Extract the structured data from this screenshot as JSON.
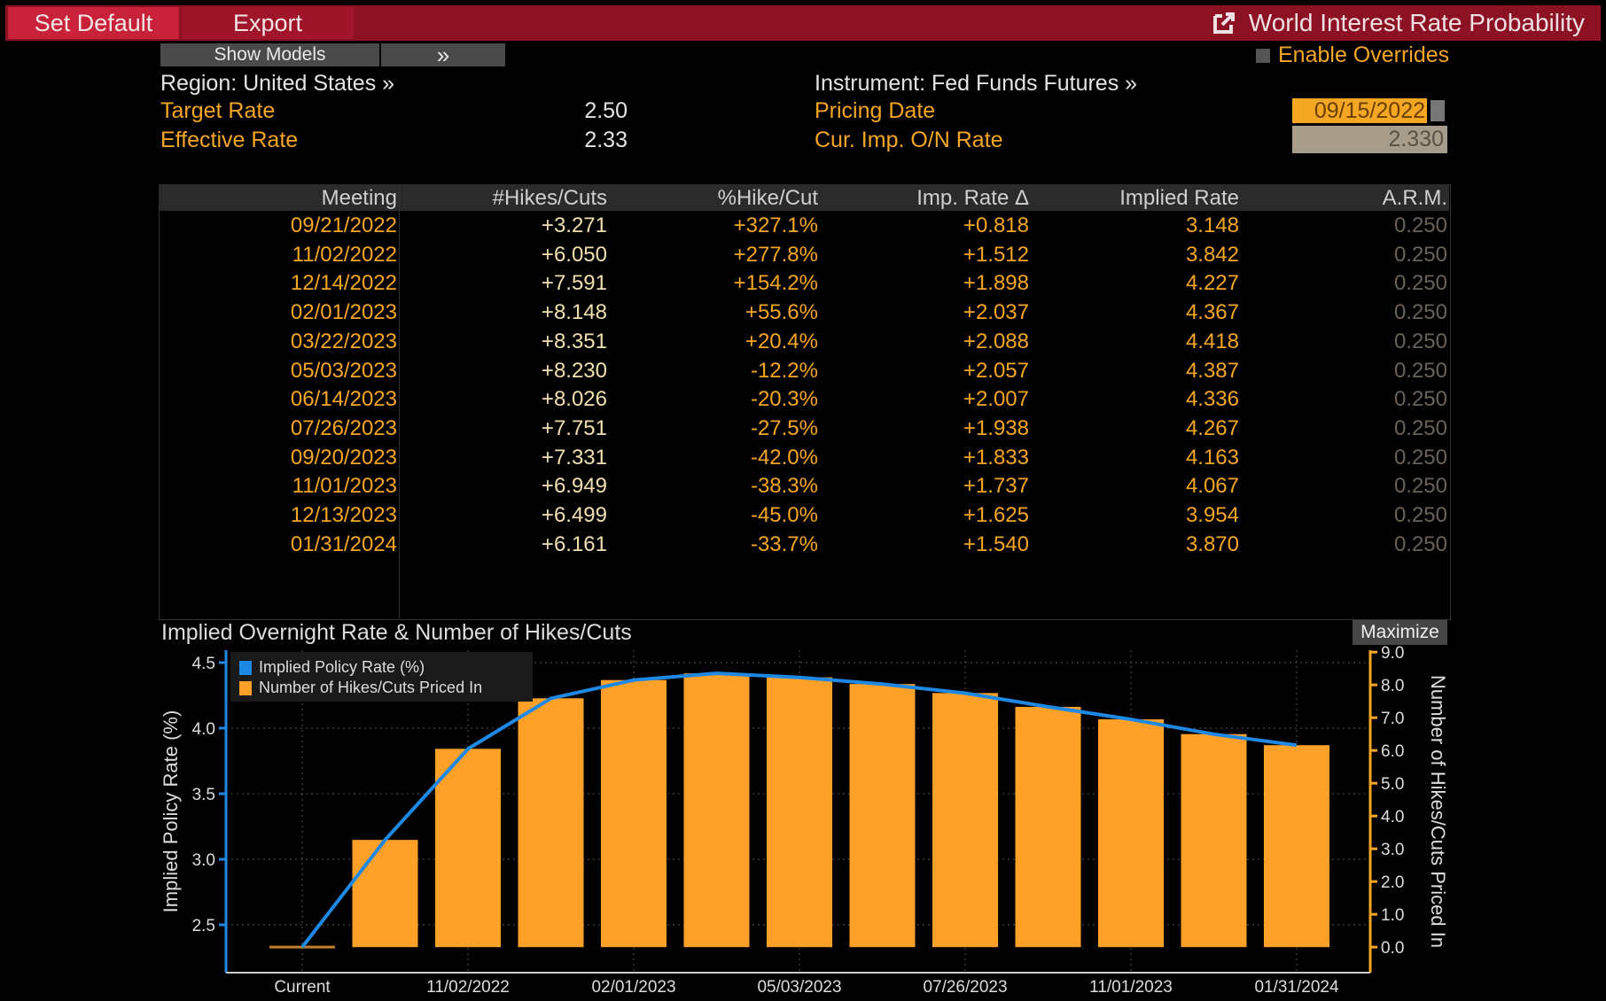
{
  "toolbar": {
    "set_default": "Set Default",
    "export": "Export",
    "show_models": "Show Models",
    "expand": "»"
  },
  "window": {
    "title": "World Interest Rate Probability",
    "icon": "external-link-icon"
  },
  "overrides": {
    "label": "Enable Overrides",
    "checked": false
  },
  "region": {
    "label": "Region: United States »"
  },
  "instrument": {
    "label": "Instrument: Fed Funds Futures »"
  },
  "fields": {
    "target_rate_label": "Target Rate",
    "target_rate": "2.50",
    "effective_rate_label": "Effective Rate",
    "effective_rate": "2.33",
    "pricing_date_label": "Pricing Date",
    "pricing_date": "09/15/2022",
    "cur_imp_label": "Cur. Imp. O/N Rate",
    "cur_imp": "2.330"
  },
  "table": {
    "headers": [
      "Meeting",
      "#Hikes/Cuts",
      "%Hike/Cut",
      "Imp. Rate Δ",
      "Implied Rate",
      "A.R.M."
    ],
    "rows": [
      [
        "09/21/2022",
        "+3.271",
        "+327.1%",
        "+0.818",
        "3.148",
        "0.250"
      ],
      [
        "11/02/2022",
        "+6.050",
        "+277.8%",
        "+1.512",
        "3.842",
        "0.250"
      ],
      [
        "12/14/2022",
        "+7.591",
        "+154.2%",
        "+1.898",
        "4.227",
        "0.250"
      ],
      [
        "02/01/2023",
        "+8.148",
        "+55.6%",
        "+2.037",
        "4.367",
        "0.250"
      ],
      [
        "03/22/2023",
        "+8.351",
        "+20.4%",
        "+2.088",
        "4.418",
        "0.250"
      ],
      [
        "05/03/2023",
        "+8.230",
        "-12.2%",
        "+2.057",
        "4.387",
        "0.250"
      ],
      [
        "06/14/2023",
        "+8.026",
        "-20.3%",
        "+2.007",
        "4.336",
        "0.250"
      ],
      [
        "07/26/2023",
        "+7.751",
        "-27.5%",
        "+1.938",
        "4.267",
        "0.250"
      ],
      [
        "09/20/2023",
        "+7.331",
        "-42.0%",
        "+1.833",
        "4.163",
        "0.250"
      ],
      [
        "11/01/2023",
        "+6.949",
        "-38.3%",
        "+1.737",
        "4.067",
        "0.250"
      ],
      [
        "12/13/2023",
        "+6.499",
        "-45.0%",
        "+1.625",
        "3.954",
        "0.250"
      ],
      [
        "01/31/2024",
        "+6.161",
        "-33.7%",
        "+1.540",
        "3.870",
        "0.250"
      ]
    ]
  },
  "chart": {
    "title": "Implied Overnight Rate & Number of Hikes/Cuts",
    "maximize": "Maximize"
  },
  "chart_data": {
    "type": "bar+line",
    "categories": [
      "Current",
      "09/21/2022",
      "11/02/2022",
      "12/14/2022",
      "02/01/2023",
      "03/22/2023",
      "05/03/2023",
      "06/14/2023",
      "07/26/2023",
      "09/20/2023",
      "11/01/2023",
      "12/13/2023",
      "01/31/2024"
    ],
    "x_tick_labels": [
      "Current",
      "11/02/2022",
      "02/01/2023",
      "05/03/2023",
      "07/26/2023",
      "11/01/2023",
      "01/31/2024"
    ],
    "series": [
      {
        "name": "Implied Policy Rate (%)",
        "type": "line",
        "axis": "left",
        "color": "#1e88e5",
        "values": [
          2.33,
          3.148,
          3.842,
          4.227,
          4.367,
          4.418,
          4.387,
          4.336,
          4.267,
          4.163,
          4.067,
          3.954,
          3.87
        ]
      },
      {
        "name": "Number of Hikes/Cuts Priced In",
        "type": "bar",
        "axis": "right",
        "color": "#ffa028",
        "values": [
          0,
          3.271,
          6.05,
          7.591,
          8.148,
          8.351,
          8.23,
          8.026,
          7.751,
          7.331,
          6.949,
          6.499,
          6.161
        ]
      }
    ],
    "ylabel_left": "Implied Policy Rate (%)",
    "ylabel_right": "Number of Hikes/Cuts Priced In",
    "left_ticks": [
      "2.5",
      "3.0",
      "3.5",
      "4.0",
      "4.5"
    ],
    "right_ticks": [
      "0.0",
      "1.0",
      "2.0",
      "3.0",
      "4.0",
      "5.0",
      "6.0",
      "7.0",
      "8.0",
      "9.0"
    ],
    "ylim_left": [
      2.135,
      4.595
    ],
    "legend": "top-left",
    "grid": true
  }
}
